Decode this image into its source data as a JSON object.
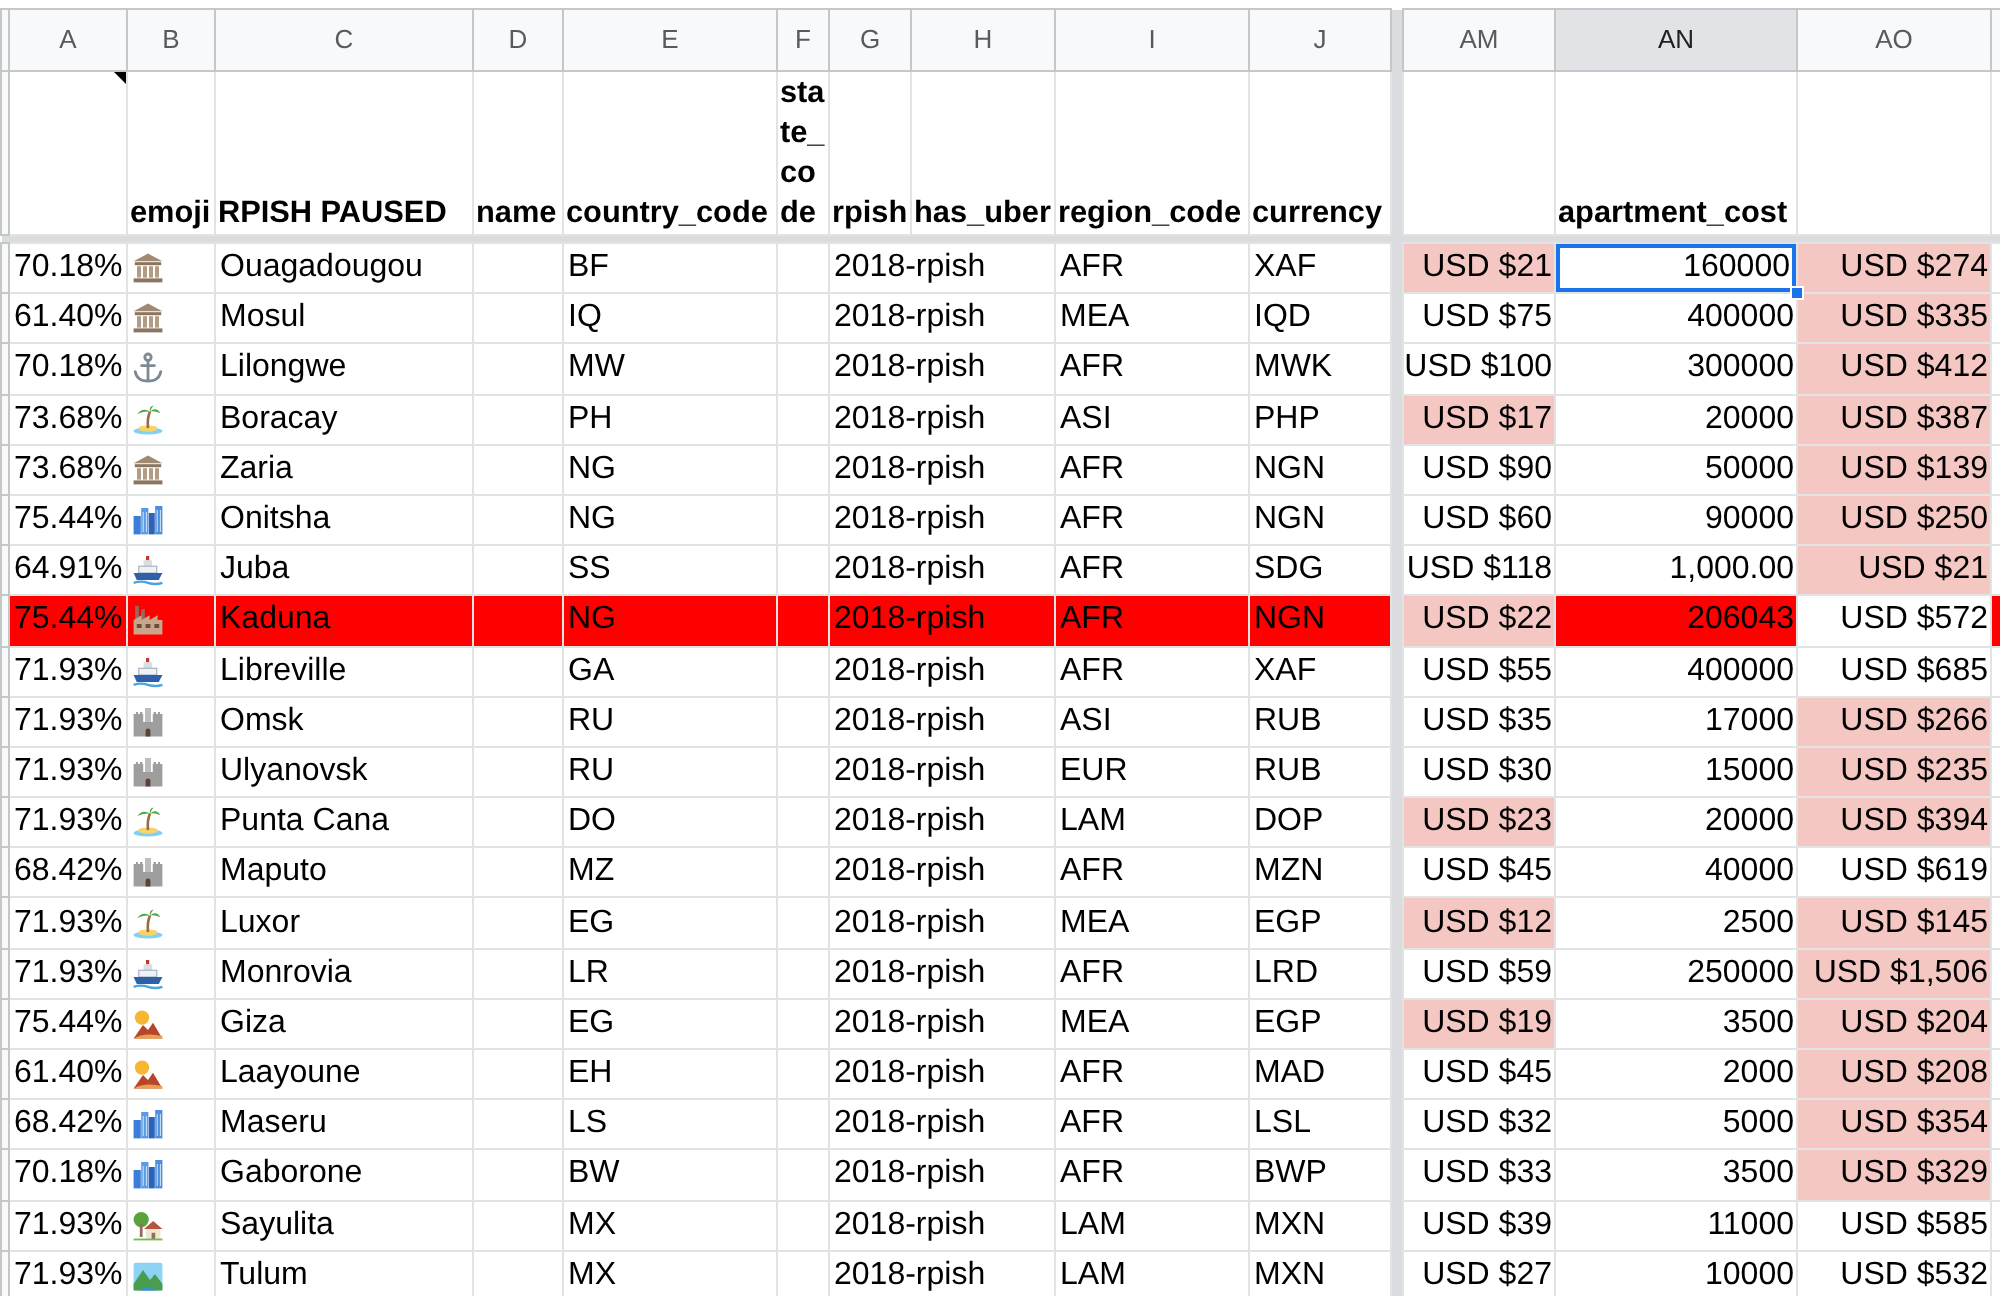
{
  "columns": [
    {
      "letter": "A",
      "note": true,
      "selected": false
    },
    {
      "letter": "B",
      "label": "emoji",
      "note": false,
      "selected": false
    },
    {
      "letter": "C",
      "label": "RPISH PAUSED",
      "note": false,
      "selected": false
    },
    {
      "letter": "D",
      "label": "name",
      "note": false,
      "selected": false
    },
    {
      "letter": "E",
      "label": "country_code",
      "note": false,
      "selected": false
    },
    {
      "letter": "F",
      "label": "state_code",
      "note": false,
      "selected": false
    },
    {
      "letter": "G",
      "label": "rpish",
      "note": false,
      "selected": false
    },
    {
      "letter": "H",
      "label": "has_uber",
      "note": false,
      "selected": false
    },
    {
      "letter": "I",
      "label": "region_code",
      "note": false,
      "selected": false
    },
    {
      "letter": "J",
      "label": "currency",
      "note": false,
      "selected": false
    },
    {
      "letter": "AM",
      "note": false,
      "selected": false
    },
    {
      "letter": "AN",
      "label": "apartment_cost",
      "note": false,
      "selected": true
    },
    {
      "letter": "AO",
      "note": false,
      "selected": false
    }
  ],
  "rows": [
    {
      "highlighted": false,
      "column_a": "70.18%",
      "emoji": {
        "kind": "museum"
      },
      "rpish_paused": "Ouagadougou",
      "country_code": "BF",
      "rpish": "2018-rpish",
      "region_code": "AFR",
      "currency": "XAF",
      "column_am": {
        "text": "USD $21",
        "flagged": true
      },
      "apartment_cost": {
        "text": "160000",
        "selected": true
      },
      "column_ao": {
        "text": "USD $274",
        "flagged": true
      }
    },
    {
      "highlighted": false,
      "column_a": "61.40%",
      "emoji": {
        "kind": "museum"
      },
      "rpish_paused": "Mosul",
      "country_code": "IQ",
      "rpish": "2018-rpish",
      "region_code": "MEA",
      "currency": "IQD",
      "column_am": {
        "text": "USD $75",
        "flagged": false
      },
      "apartment_cost": {
        "text": "400000",
        "selected": false
      },
      "column_ao": {
        "text": "USD $335",
        "flagged": true
      }
    },
    {
      "highlighted": false,
      "column_a": "70.18%",
      "emoji": {
        "kind": "anchor"
      },
      "rpish_paused": "Lilongwe",
      "country_code": "MW",
      "rpish": "2018-rpish",
      "region_code": "AFR",
      "currency": "MWK",
      "column_am": {
        "text": "USD $100",
        "flagged": false
      },
      "apartment_cost": {
        "text": "300000",
        "selected": false
      },
      "column_ao": {
        "text": "USD $412",
        "flagged": true
      }
    },
    {
      "highlighted": false,
      "column_a": "73.68%",
      "emoji": {
        "kind": "island"
      },
      "rpish_paused": "Boracay",
      "country_code": "PH",
      "rpish": "2018-rpish",
      "region_code": "ASI",
      "currency": "PHP",
      "column_am": {
        "text": "USD $17",
        "flagged": true
      },
      "apartment_cost": {
        "text": "20000",
        "selected": false
      },
      "column_ao": {
        "text": "USD $387",
        "flagged": true
      }
    },
    {
      "highlighted": false,
      "column_a": "73.68%",
      "emoji": {
        "kind": "museum"
      },
      "rpish_paused": "Zaria",
      "country_code": "NG",
      "rpish": "2018-rpish",
      "region_code": "AFR",
      "currency": "NGN",
      "column_am": {
        "text": "USD $90",
        "flagged": false
      },
      "apartment_cost": {
        "text": "50000",
        "selected": false
      },
      "column_ao": {
        "text": "USD $139",
        "flagged": true
      }
    },
    {
      "highlighted": false,
      "column_a": "75.44%",
      "emoji": {
        "kind": "city"
      },
      "rpish_paused": "Onitsha",
      "country_code": "NG",
      "rpish": "2018-rpish",
      "region_code": "AFR",
      "currency": "NGN",
      "column_am": {
        "text": "USD $60",
        "flagged": false
      },
      "apartment_cost": {
        "text": "90000",
        "selected": false
      },
      "column_ao": {
        "text": "USD $250",
        "flagged": true
      }
    },
    {
      "highlighted": false,
      "column_a": "64.91%",
      "emoji": {
        "kind": "ship"
      },
      "rpish_paused": "Juba",
      "country_code": "SS",
      "rpish": "2018-rpish",
      "region_code": "AFR",
      "currency": "SDG",
      "column_am": {
        "text": "USD $118",
        "flagged": false
      },
      "apartment_cost": {
        "text": "1,000.00",
        "selected": false
      },
      "column_ao": {
        "text": "USD $21",
        "flagged": true
      }
    },
    {
      "highlighted": true,
      "column_a": "75.44%",
      "emoji": {
        "kind": "factory"
      },
      "rpish_paused": "Kaduna",
      "country_code": "NG",
      "rpish": "2018-rpish",
      "region_code": "AFR",
      "currency": "NGN",
      "column_am": {
        "text": "USD $22",
        "flagged": true
      },
      "apartment_cost": {
        "text": "206043",
        "selected": false
      },
      "column_ao": {
        "text": "USD $572",
        "flagged": false
      }
    },
    {
      "highlighted": false,
      "column_a": "71.93%",
      "emoji": {
        "kind": "ship"
      },
      "rpish_paused": "Libreville",
      "country_code": "GA",
      "rpish": "2018-rpish",
      "region_code": "AFR",
      "currency": "XAF",
      "column_am": {
        "text": "USD $55",
        "flagged": false
      },
      "apartment_cost": {
        "text": "400000",
        "selected": false
      },
      "column_ao": {
        "text": "USD $685",
        "flagged": false
      }
    },
    {
      "highlighted": false,
      "column_a": "71.93%",
      "emoji": {
        "kind": "castle"
      },
      "rpish_paused": "Omsk",
      "country_code": "RU",
      "rpish": "2018-rpish",
      "region_code": "ASI",
      "currency": "RUB",
      "column_am": {
        "text": "USD $35",
        "flagged": false
      },
      "apartment_cost": {
        "text": "17000",
        "selected": false
      },
      "column_ao": {
        "text": "USD $266",
        "flagged": true
      }
    },
    {
      "highlighted": false,
      "column_a": "71.93%",
      "emoji": {
        "kind": "castle"
      },
      "rpish_paused": "Ulyanovsk",
      "country_code": "RU",
      "rpish": "2018-rpish",
      "region_code": "EUR",
      "currency": "RUB",
      "column_am": {
        "text": "USD $30",
        "flagged": false
      },
      "apartment_cost": {
        "text": "15000",
        "selected": false
      },
      "column_ao": {
        "text": "USD $235",
        "flagged": true
      }
    },
    {
      "highlighted": false,
      "column_a": "71.93%",
      "emoji": {
        "kind": "island"
      },
      "rpish_paused": "Punta Cana",
      "country_code": "DO",
      "rpish": "2018-rpish",
      "region_code": "LAM",
      "currency": "DOP",
      "column_am": {
        "text": "USD $23",
        "flagged": true
      },
      "apartment_cost": {
        "text": "20000",
        "selected": false
      },
      "column_ao": {
        "text": "USD $394",
        "flagged": true
      }
    },
    {
      "highlighted": false,
      "column_a": "68.42%",
      "emoji": {
        "kind": "castle"
      },
      "rpish_paused": "Maputo",
      "country_code": "MZ",
      "rpish": "2018-rpish",
      "region_code": "AFR",
      "currency": "MZN",
      "column_am": {
        "text": "USD $45",
        "flagged": false
      },
      "apartment_cost": {
        "text": "40000",
        "selected": false
      },
      "column_ao": {
        "text": "USD $619",
        "flagged": false
      }
    },
    {
      "highlighted": false,
      "column_a": "71.93%",
      "emoji": {
        "kind": "island"
      },
      "rpish_paused": "Luxor",
      "country_code": "EG",
      "rpish": "2018-rpish",
      "region_code": "MEA",
      "currency": "EGP",
      "column_am": {
        "text": "USD $12",
        "flagged": true
      },
      "apartment_cost": {
        "text": "2500",
        "selected": false
      },
      "column_ao": {
        "text": "USD $145",
        "flagged": true
      }
    },
    {
      "highlighted": false,
      "column_a": "71.93%",
      "emoji": {
        "kind": "ship"
      },
      "rpish_paused": "Monrovia",
      "country_code": "LR",
      "rpish": "2018-rpish",
      "region_code": "AFR",
      "currency": "LRD",
      "column_am": {
        "text": "USD $59",
        "flagged": false
      },
      "apartment_cost": {
        "text": "250000",
        "selected": false
      },
      "column_ao": {
        "text": "USD $1,506",
        "flagged": true
      }
    },
    {
      "highlighted": false,
      "column_a": "75.44%",
      "emoji": {
        "kind": "desert"
      },
      "rpish_paused": "Giza",
      "country_code": "EG",
      "rpish": "2018-rpish",
      "region_code": "MEA",
      "currency": "EGP",
      "column_am": {
        "text": "USD $19",
        "flagged": true
      },
      "apartment_cost": {
        "text": "3500",
        "selected": false
      },
      "column_ao": {
        "text": "USD $204",
        "flagged": true
      }
    },
    {
      "highlighted": false,
      "column_a": "61.40%",
      "emoji": {
        "kind": "desert"
      },
      "rpish_paused": "Laayoune",
      "country_code": "EH",
      "rpish": "2018-rpish",
      "region_code": "AFR",
      "currency": "MAD",
      "column_am": {
        "text": "USD $45",
        "flagged": false
      },
      "apartment_cost": {
        "text": "2000",
        "selected": false
      },
      "column_ao": {
        "text": "USD $208",
        "flagged": true
      }
    },
    {
      "highlighted": false,
      "column_a": "68.42%",
      "emoji": {
        "kind": "city"
      },
      "rpish_paused": "Maseru",
      "country_code": "LS",
      "rpish": "2018-rpish",
      "region_code": "AFR",
      "currency": "LSL",
      "column_am": {
        "text": "USD $32",
        "flagged": false
      },
      "apartment_cost": {
        "text": "5000",
        "selected": false
      },
      "column_ao": {
        "text": "USD $354",
        "flagged": true
      }
    },
    {
      "highlighted": false,
      "column_a": "70.18%",
      "emoji": {
        "kind": "city"
      },
      "rpish_paused": "Gaborone",
      "country_code": "BW",
      "rpish": "2018-rpish",
      "region_code": "AFR",
      "currency": "BWP",
      "column_am": {
        "text": "USD $33",
        "flagged": false
      },
      "apartment_cost": {
        "text": "3500",
        "selected": false
      },
      "column_ao": {
        "text": "USD $329",
        "flagged": true
      }
    },
    {
      "highlighted": false,
      "column_a": "71.93%",
      "emoji": {
        "kind": "house"
      },
      "rpish_paused": "Sayulita",
      "country_code": "MX",
      "rpish": "2018-rpish",
      "region_code": "LAM",
      "currency": "MXN",
      "column_am": {
        "text": "USD $39",
        "flagged": false
      },
      "apartment_cost": {
        "text": "11000",
        "selected": false
      },
      "column_ao": {
        "text": "USD $585",
        "flagged": false
      }
    },
    {
      "highlighted": false,
      "column_a": "71.93%",
      "emoji": {
        "kind": "park"
      },
      "rpish_paused": "Tulum",
      "country_code": "MX",
      "rpish": "2018-rpish",
      "region_code": "LAM",
      "currency": "MXN",
      "column_am": {
        "text": "USD $27",
        "flagged": false
      },
      "apartment_cost": {
        "text": "10000",
        "selected": false
      },
      "column_ao": {
        "text": "USD $532",
        "flagged": false
      }
    }
  ]
}
